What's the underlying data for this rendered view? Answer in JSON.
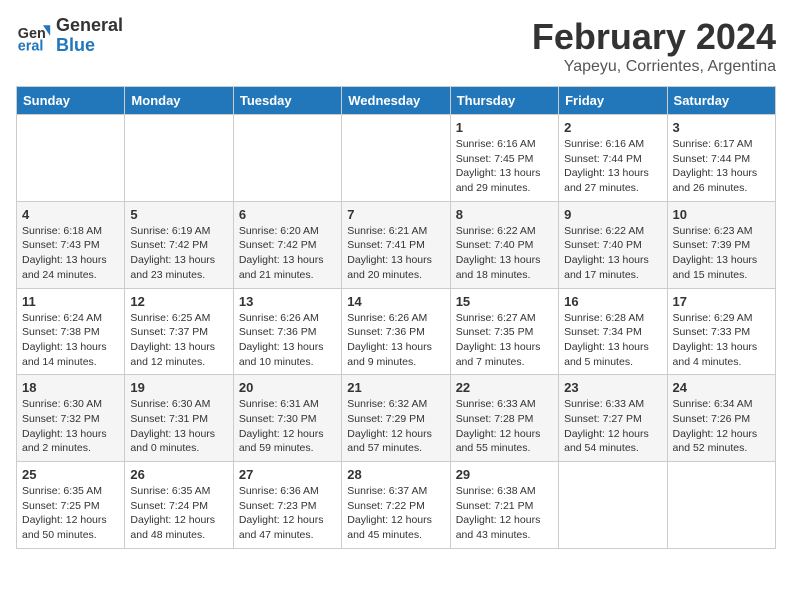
{
  "logo": {
    "line1": "General",
    "line2": "Blue"
  },
  "title": "February 2024",
  "subtitle": "Yapeyu, Corrientes, Argentina",
  "days_of_week": [
    "Sunday",
    "Monday",
    "Tuesday",
    "Wednesday",
    "Thursday",
    "Friday",
    "Saturday"
  ],
  "weeks": [
    [
      {
        "day": "",
        "info": ""
      },
      {
        "day": "",
        "info": ""
      },
      {
        "day": "",
        "info": ""
      },
      {
        "day": "",
        "info": ""
      },
      {
        "day": "1",
        "info": "Sunrise: 6:16 AM\nSunset: 7:45 PM\nDaylight: 13 hours and 29 minutes."
      },
      {
        "day": "2",
        "info": "Sunrise: 6:16 AM\nSunset: 7:44 PM\nDaylight: 13 hours and 27 minutes."
      },
      {
        "day": "3",
        "info": "Sunrise: 6:17 AM\nSunset: 7:44 PM\nDaylight: 13 hours and 26 minutes."
      }
    ],
    [
      {
        "day": "4",
        "info": "Sunrise: 6:18 AM\nSunset: 7:43 PM\nDaylight: 13 hours and 24 minutes."
      },
      {
        "day": "5",
        "info": "Sunrise: 6:19 AM\nSunset: 7:42 PM\nDaylight: 13 hours and 23 minutes."
      },
      {
        "day": "6",
        "info": "Sunrise: 6:20 AM\nSunset: 7:42 PM\nDaylight: 13 hours and 21 minutes."
      },
      {
        "day": "7",
        "info": "Sunrise: 6:21 AM\nSunset: 7:41 PM\nDaylight: 13 hours and 20 minutes."
      },
      {
        "day": "8",
        "info": "Sunrise: 6:22 AM\nSunset: 7:40 PM\nDaylight: 13 hours and 18 minutes."
      },
      {
        "day": "9",
        "info": "Sunrise: 6:22 AM\nSunset: 7:40 PM\nDaylight: 13 hours and 17 minutes."
      },
      {
        "day": "10",
        "info": "Sunrise: 6:23 AM\nSunset: 7:39 PM\nDaylight: 13 hours and 15 minutes."
      }
    ],
    [
      {
        "day": "11",
        "info": "Sunrise: 6:24 AM\nSunset: 7:38 PM\nDaylight: 13 hours and 14 minutes."
      },
      {
        "day": "12",
        "info": "Sunrise: 6:25 AM\nSunset: 7:37 PM\nDaylight: 13 hours and 12 minutes."
      },
      {
        "day": "13",
        "info": "Sunrise: 6:26 AM\nSunset: 7:36 PM\nDaylight: 13 hours and 10 minutes."
      },
      {
        "day": "14",
        "info": "Sunrise: 6:26 AM\nSunset: 7:36 PM\nDaylight: 13 hours and 9 minutes."
      },
      {
        "day": "15",
        "info": "Sunrise: 6:27 AM\nSunset: 7:35 PM\nDaylight: 13 hours and 7 minutes."
      },
      {
        "day": "16",
        "info": "Sunrise: 6:28 AM\nSunset: 7:34 PM\nDaylight: 13 hours and 5 minutes."
      },
      {
        "day": "17",
        "info": "Sunrise: 6:29 AM\nSunset: 7:33 PM\nDaylight: 13 hours and 4 minutes."
      }
    ],
    [
      {
        "day": "18",
        "info": "Sunrise: 6:30 AM\nSunset: 7:32 PM\nDaylight: 13 hours and 2 minutes."
      },
      {
        "day": "19",
        "info": "Sunrise: 6:30 AM\nSunset: 7:31 PM\nDaylight: 13 hours and 0 minutes."
      },
      {
        "day": "20",
        "info": "Sunrise: 6:31 AM\nSunset: 7:30 PM\nDaylight: 12 hours and 59 minutes."
      },
      {
        "day": "21",
        "info": "Sunrise: 6:32 AM\nSunset: 7:29 PM\nDaylight: 12 hours and 57 minutes."
      },
      {
        "day": "22",
        "info": "Sunrise: 6:33 AM\nSunset: 7:28 PM\nDaylight: 12 hours and 55 minutes."
      },
      {
        "day": "23",
        "info": "Sunrise: 6:33 AM\nSunset: 7:27 PM\nDaylight: 12 hours and 54 minutes."
      },
      {
        "day": "24",
        "info": "Sunrise: 6:34 AM\nSunset: 7:26 PM\nDaylight: 12 hours and 52 minutes."
      }
    ],
    [
      {
        "day": "25",
        "info": "Sunrise: 6:35 AM\nSunset: 7:25 PM\nDaylight: 12 hours and 50 minutes."
      },
      {
        "day": "26",
        "info": "Sunrise: 6:35 AM\nSunset: 7:24 PM\nDaylight: 12 hours and 48 minutes."
      },
      {
        "day": "27",
        "info": "Sunrise: 6:36 AM\nSunset: 7:23 PM\nDaylight: 12 hours and 47 minutes."
      },
      {
        "day": "28",
        "info": "Sunrise: 6:37 AM\nSunset: 7:22 PM\nDaylight: 12 hours and 45 minutes."
      },
      {
        "day": "29",
        "info": "Sunrise: 6:38 AM\nSunset: 7:21 PM\nDaylight: 12 hours and 43 minutes."
      },
      {
        "day": "",
        "info": ""
      },
      {
        "day": "",
        "info": ""
      }
    ]
  ]
}
